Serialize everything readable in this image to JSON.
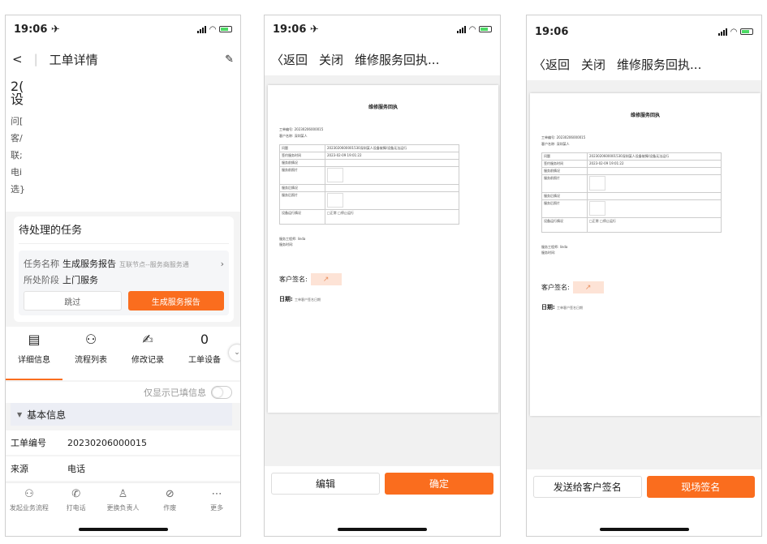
{
  "phone1": {
    "time": "19:06 ✈",
    "nav": {
      "back": "<",
      "title": "工单详情",
      "edit_icon": "pencil-icon"
    },
    "body": {
      "l1": "2(",
      "l2": "设",
      "l3": "问[",
      "l4": "客/",
      "l5": "联;",
      "l6": "电i",
      "l7": "选}"
    },
    "task": {
      "heading": "待处理的任务",
      "name_label": "任务名称",
      "name_value": "生成服务报告",
      "name_sub": "互联节点--服务商服务通",
      "stage_label": "所处阶段",
      "stage_value": "上门服务",
      "skip": "跳过",
      "generate": "生成服务报告"
    },
    "tabs": [
      {
        "label": "详细信息",
        "icon": "list-icon"
      },
      {
        "label": "流程列表",
        "icon": "tree-icon"
      },
      {
        "label": "修改记录",
        "icon": "edit-doc-icon"
      },
      {
        "label": "工单设备",
        "icon": "count-icon",
        "count": "0"
      }
    ],
    "toggle_label": "仅显示已填信息",
    "section": "基本信息",
    "fields": [
      {
        "label": "工单编号",
        "value": "20230206000015"
      },
      {
        "label": "来源",
        "value": "电话"
      }
    ],
    "bottom": [
      {
        "label": "发起业务流程",
        "icon": "flow-icon"
      },
      {
        "label": "打电话",
        "icon": "phone-icon"
      },
      {
        "label": "更换负责人",
        "icon": "user-swap-icon"
      },
      {
        "label": "作废",
        "icon": "void-icon"
      },
      {
        "label": "更多",
        "icon": "more-icon"
      }
    ]
  },
  "phone2": {
    "time": "19:06 ✈",
    "nav": {
      "back": "〈返回",
      "close": "关闭",
      "title": "维修服务回执..."
    },
    "doc": {
      "title": "维修服务回执",
      "meta1": "工单编号: 20230206000015",
      "meta2": "客户名称: 深圳某人",
      "rows": [
        {
          "l": "问题",
          "v": "2023020600001530深圳某人设备故障/设备无法运行"
        },
        {
          "l": "签约服务时间",
          "v": "2023-02-09 19:01:22"
        },
        {
          "l": "服务前情况",
          "v": ""
        },
        {
          "l": "服务前照片",
          "v": ""
        },
        {
          "l": "服务后情况",
          "v": ""
        },
        {
          "l": "服务后照片",
          "v": ""
        },
        {
          "l": "设备运行情况",
          "v": "□正常 □停止运行"
        }
      ],
      "engineer": "服务工程师: linda",
      "svc_time": "服务时间:",
      "sig_label": "客户签名:",
      "date_label": "日期:",
      "date_val": "工单客户签名日期"
    },
    "buttons": {
      "left": "编辑",
      "right": "确定"
    }
  },
  "phone3": {
    "time": "19:06",
    "nav": {
      "back": "〈返回",
      "close": "关闭",
      "title": "维修服务回执..."
    },
    "buttons": {
      "left": "发送给客户签名",
      "right": "现场签名"
    }
  }
}
